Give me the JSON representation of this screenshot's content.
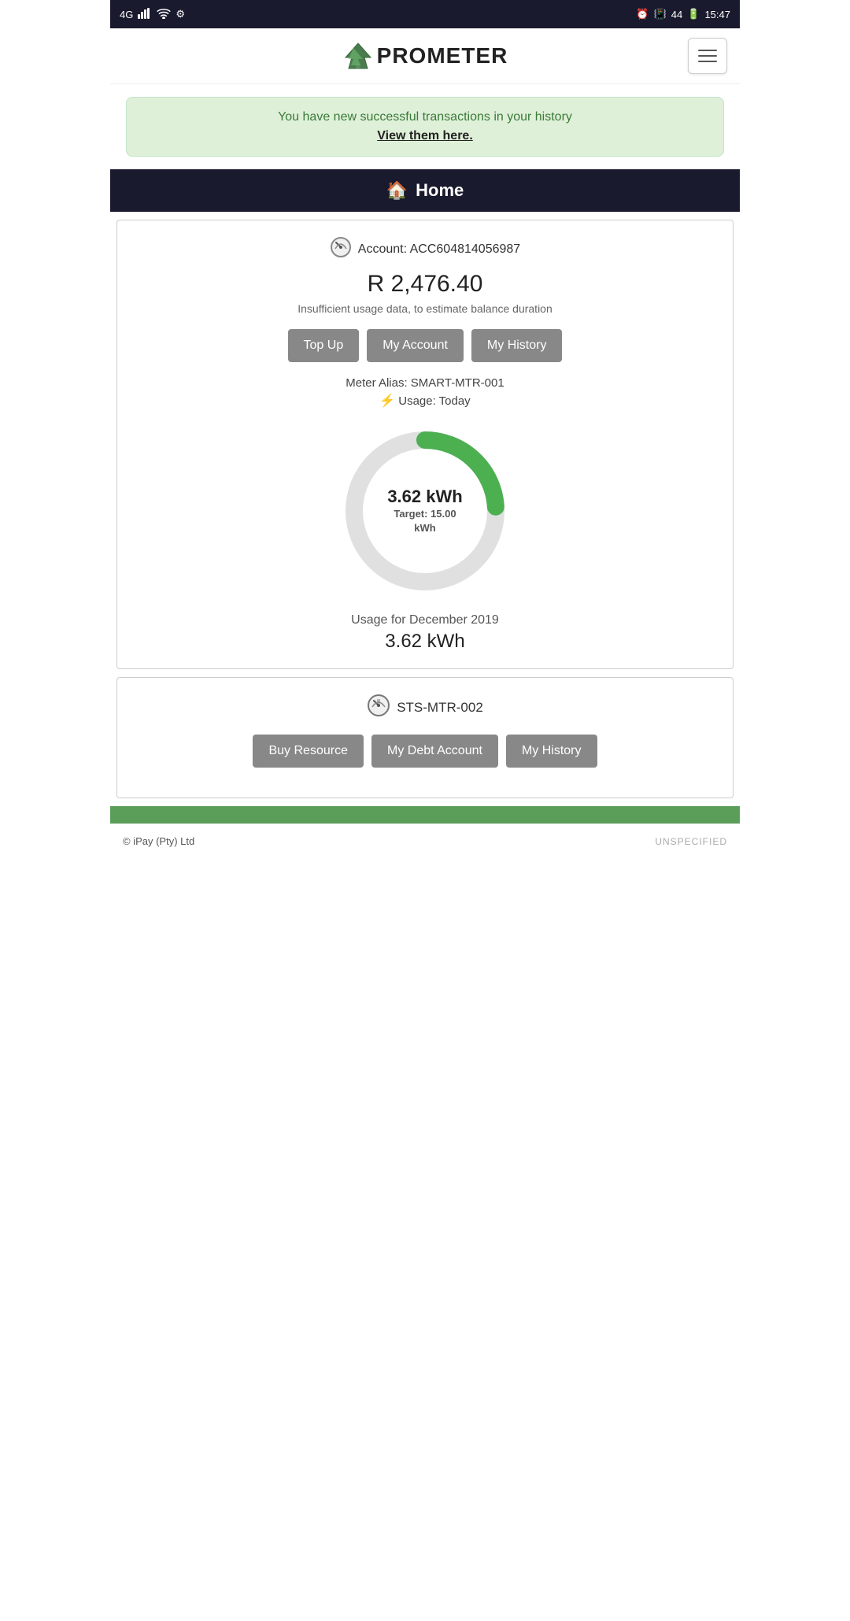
{
  "statusBar": {
    "left": "4G",
    "time": "15:47",
    "battery": "44"
  },
  "header": {
    "logoText": "PROMETER",
    "hamburgerLabel": "Menu"
  },
  "notification": {
    "mainText": "You have new successful transactions in your history",
    "linkText": "View them here."
  },
  "homeHeader": {
    "title": "Home",
    "icon": "🏠"
  },
  "meterCard1": {
    "accountLabel": "Account: ACC604814056987",
    "balance": "R 2,476.40",
    "subtitle": "Insufficient usage data, to estimate balance duration",
    "topUpBtn": "Top Up",
    "myAccountBtn": "My Account",
    "myHistoryBtn": "My History",
    "meterAlias": "Meter Alias: SMART-MTR-001",
    "usageLabel": "Usage: Today",
    "donut": {
      "value": "3.62 kWh",
      "target": "Target: 15.00 kWh",
      "current": 3.62,
      "max": 15.0,
      "color": "#4caf50",
      "trackColor": "#e0e0e0"
    },
    "usageMonth": "Usage for December 2019",
    "usageKwh": "3.62 kWh"
  },
  "meterCard2": {
    "name": "STS-MTR-002",
    "buyResourceBtn": "Buy Resource",
    "myDebtAccountBtn": "My Debt Account",
    "myHistoryBtn": "My History"
  },
  "footer": {
    "copyright": "© iPay (Pty) Ltd",
    "unspecified": "UNSPECIFIED"
  }
}
